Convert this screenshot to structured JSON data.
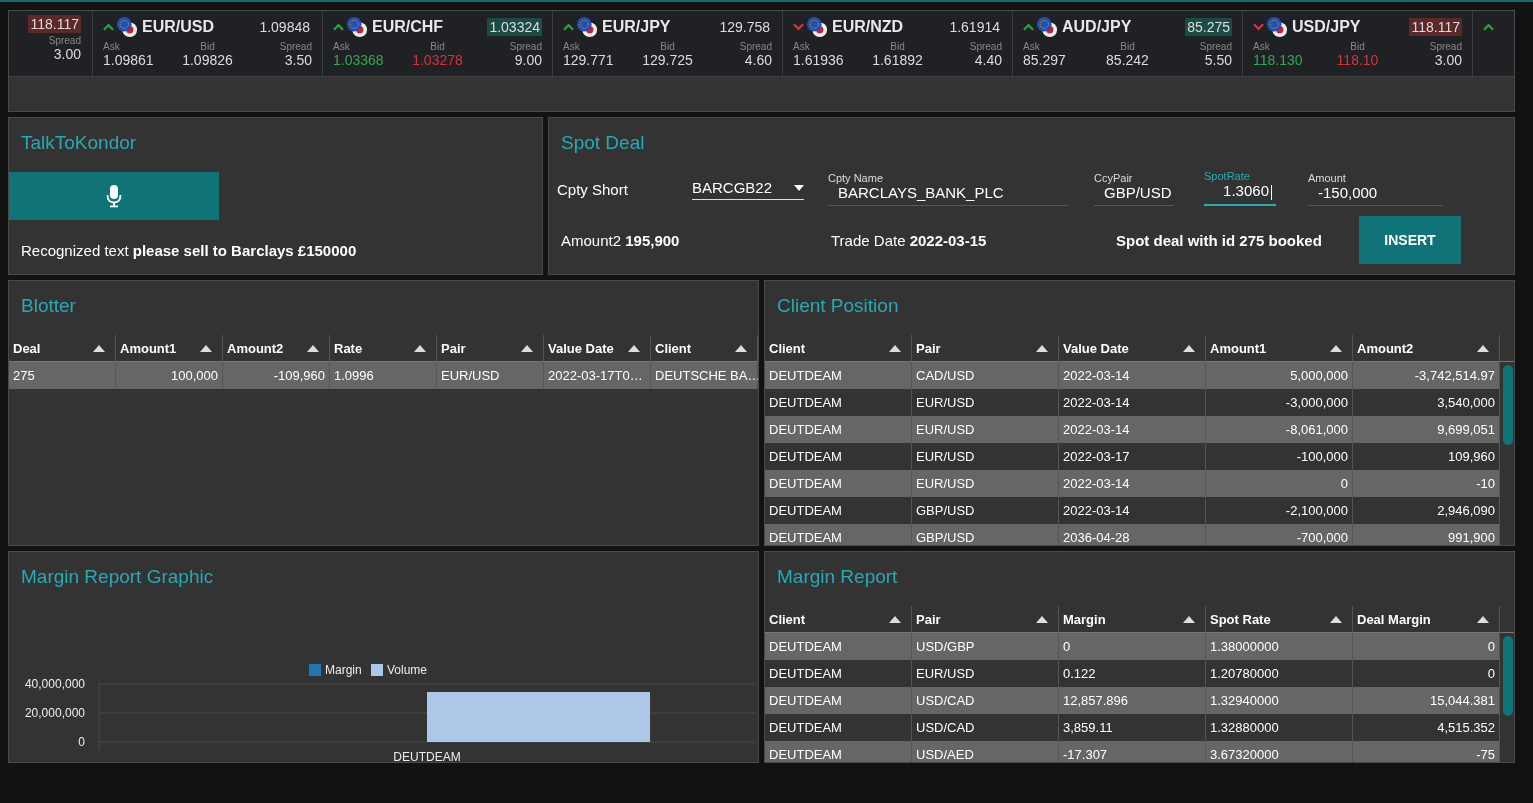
{
  "ticker": [
    {
      "kind": "partial-start",
      "rising": false,
      "price": "118.117",
      "price_highlighted": true,
      "spread_label": "Spread",
      "spread": "3.00"
    },
    {
      "kind": "card",
      "pair": "EUR/USD",
      "rising": true,
      "price": "1.09848",
      "price_highlighted": false,
      "ask_label": "Ask",
      "bid_label": "Bid",
      "spread_label": "Spread",
      "ask": "1.09861",
      "bid": "1.09826",
      "spread": "3.50",
      "ask_rose": false,
      "bid_fell": false
    },
    {
      "kind": "card",
      "pair": "EUR/CHF",
      "rising": true,
      "price": "1.03324",
      "price_highlighted": true,
      "ask_label": "Ask",
      "bid_label": "Bid",
      "spread_label": "Spread",
      "ask": "1.03368",
      "bid": "1.03278",
      "spread": "9.00",
      "ask_rose": true,
      "bid_fell": true
    },
    {
      "kind": "card",
      "pair": "EUR/JPY",
      "rising": true,
      "price": "129.758",
      "price_highlighted": false,
      "ask_label": "Ask",
      "bid_label": "Bid",
      "spread_label": "Spread",
      "ask": "129.771",
      "bid": "129.725",
      "spread": "4.60",
      "ask_rose": false,
      "bid_fell": false
    },
    {
      "kind": "card",
      "pair": "EUR/NZD",
      "rising": false,
      "price": "1.61914",
      "price_highlighted": false,
      "ask_label": "Ask",
      "bid_label": "Bid",
      "spread_label": "Spread",
      "ask": "1.61936",
      "bid": "1.61892",
      "spread": "4.40",
      "ask_rose": false,
      "bid_fell": false
    },
    {
      "kind": "card",
      "pair": "AUD/JPY",
      "rising": true,
      "price": "85.275",
      "price_highlighted": true,
      "ask_label": "Ask",
      "bid_label": "Bid",
      "spread_label": "Spread",
      "ask": "85.297",
      "bid": "85.242",
      "spread": "5.50",
      "ask_rose": false,
      "bid_fell": false
    },
    {
      "kind": "card",
      "pair": "USD/JPY",
      "rising": false,
      "price": "118.117",
      "price_highlighted": true,
      "ask_label": "Ask",
      "bid_label": "Bid",
      "spread_label": "Spread",
      "ask": "118.130",
      "bid": "118.10",
      "spread": "3.00",
      "ask_rose": true,
      "bid_fell": true
    },
    {
      "kind": "partial-end",
      "rising": true
    }
  ],
  "talk": {
    "title": "TalkToKondor",
    "recognized": "Recognized text **please sell to Barclays £150000**"
  },
  "spot_deal": {
    "title": "Spot Deal",
    "cpty_short_label": "Cpty Short",
    "cpty_short": "BARCGB22",
    "fields": [
      {
        "label": "Cpty Name",
        "value": "BARCLAYS_BANK_PLC",
        "focused": false
      },
      {
        "label": "CcyPair",
        "value": "GBP/USD",
        "focused": false
      },
      {
        "label": "SpotRate",
        "value": "1.3060",
        "focused": true
      },
      {
        "label": "Amount",
        "value": "-150,000",
        "focused": false
      }
    ],
    "amount2": "Amount2 **195,900**",
    "trade_date": "Trade Date **2022-03-15**",
    "status": "Spot deal with id 275 booked",
    "button": "INSERT"
  },
  "blotter": {
    "title": "Blotter",
    "columns": [
      {
        "name": "Deal",
        "kind": "text"
      },
      {
        "name": "Amount1",
        "kind": "number"
      },
      {
        "name": "Amount2",
        "kind": "number"
      },
      {
        "name": "Rate",
        "kind": "text"
      },
      {
        "name": "Pair",
        "kind": "text"
      },
      {
        "name": "Value Date",
        "kind": "text"
      },
      {
        "name": "Client",
        "kind": "text"
      }
    ],
    "rows": [
      [
        "275",
        "100,000",
        "-109,960",
        "1.0996",
        "EUR/USD",
        "2022-03-17T0…",
        "DEUTSCHE BA…"
      ]
    ]
  },
  "client_position": {
    "title": "Client Position",
    "columns": [
      {
        "name": "Client",
        "kind": "text"
      },
      {
        "name": "Pair",
        "kind": "text"
      },
      {
        "name": "Value Date",
        "kind": "text"
      },
      {
        "name": "Amount1",
        "kind": "number"
      },
      {
        "name": "Amount2",
        "kind": "number"
      }
    ],
    "rows": [
      [
        "DEUTDEAM",
        "CAD/USD",
        "2022-03-14",
        "5,000,000",
        "-3,742,514.97"
      ],
      [
        "DEUTDEAM",
        "EUR/USD",
        "2022-03-14",
        "-3,000,000",
        "3,540,000"
      ],
      [
        "DEUTDEAM",
        "EUR/USD",
        "2022-03-14",
        "-8,061,000",
        "9,699,051"
      ],
      [
        "DEUTDEAM",
        "EUR/USD",
        "2022-03-17",
        "-100,000",
        "109,960"
      ],
      [
        "DEUTDEAM",
        "EUR/USD",
        "2022-03-14",
        "0",
        "-10"
      ],
      [
        "DEUTDEAM",
        "GBP/USD",
        "2022-03-14",
        "-2,100,000",
        "2,946,090"
      ],
      [
        "DEUTDEAM",
        "GBP/USD",
        "2036-04-28",
        "-700,000",
        "991,900"
      ]
    ]
  },
  "margin_graphic": {
    "title": "Margin Report Graphic",
    "chart_data": {
      "type": "bar",
      "categories": [
        "DEUTDEAM"
      ],
      "series": [
        {
          "name": "Margin",
          "color": "#1f77b4",
          "values": [
            0
          ]
        },
        {
          "name": "Volume",
          "color": "#aec7e8",
          "values": [
            34500000
          ]
        }
      ],
      "ylim": [
        0,
        40000000
      ],
      "yticks": [
        {
          "value": 0,
          "label": "0"
        },
        {
          "value": 20000000,
          "label": "20,000,000"
        },
        {
          "value": 40000000,
          "label": "40,000,000"
        }
      ]
    }
  },
  "margin_report": {
    "title": "Margin Report",
    "columns": [
      {
        "name": "Client",
        "kind": "text"
      },
      {
        "name": "Pair",
        "kind": "text"
      },
      {
        "name": "Margin",
        "kind": "text"
      },
      {
        "name": "Spot Rate",
        "kind": "text"
      },
      {
        "name": "Deal Margin",
        "kind": "number"
      }
    ],
    "rows": [
      [
        "DEUTDEAM",
        "USD/GBP",
        "0",
        "1.38000000",
        "0"
      ],
      [
        "DEUTDEAM",
        "EUR/USD",
        "0.122",
        "1.20780000",
        "0"
      ],
      [
        "DEUTDEAM",
        "USD/CAD",
        "12,857.896",
        "1.32940000",
        "15,044.381"
      ],
      [
        "DEUTDEAM",
        "USD/CAD",
        "3,859.11",
        "1.32880000",
        "4,515.352"
      ],
      [
        "DEUTDEAM",
        "USD/AED",
        "-17.307",
        "3.67320000",
        "-75"
      ]
    ]
  }
}
